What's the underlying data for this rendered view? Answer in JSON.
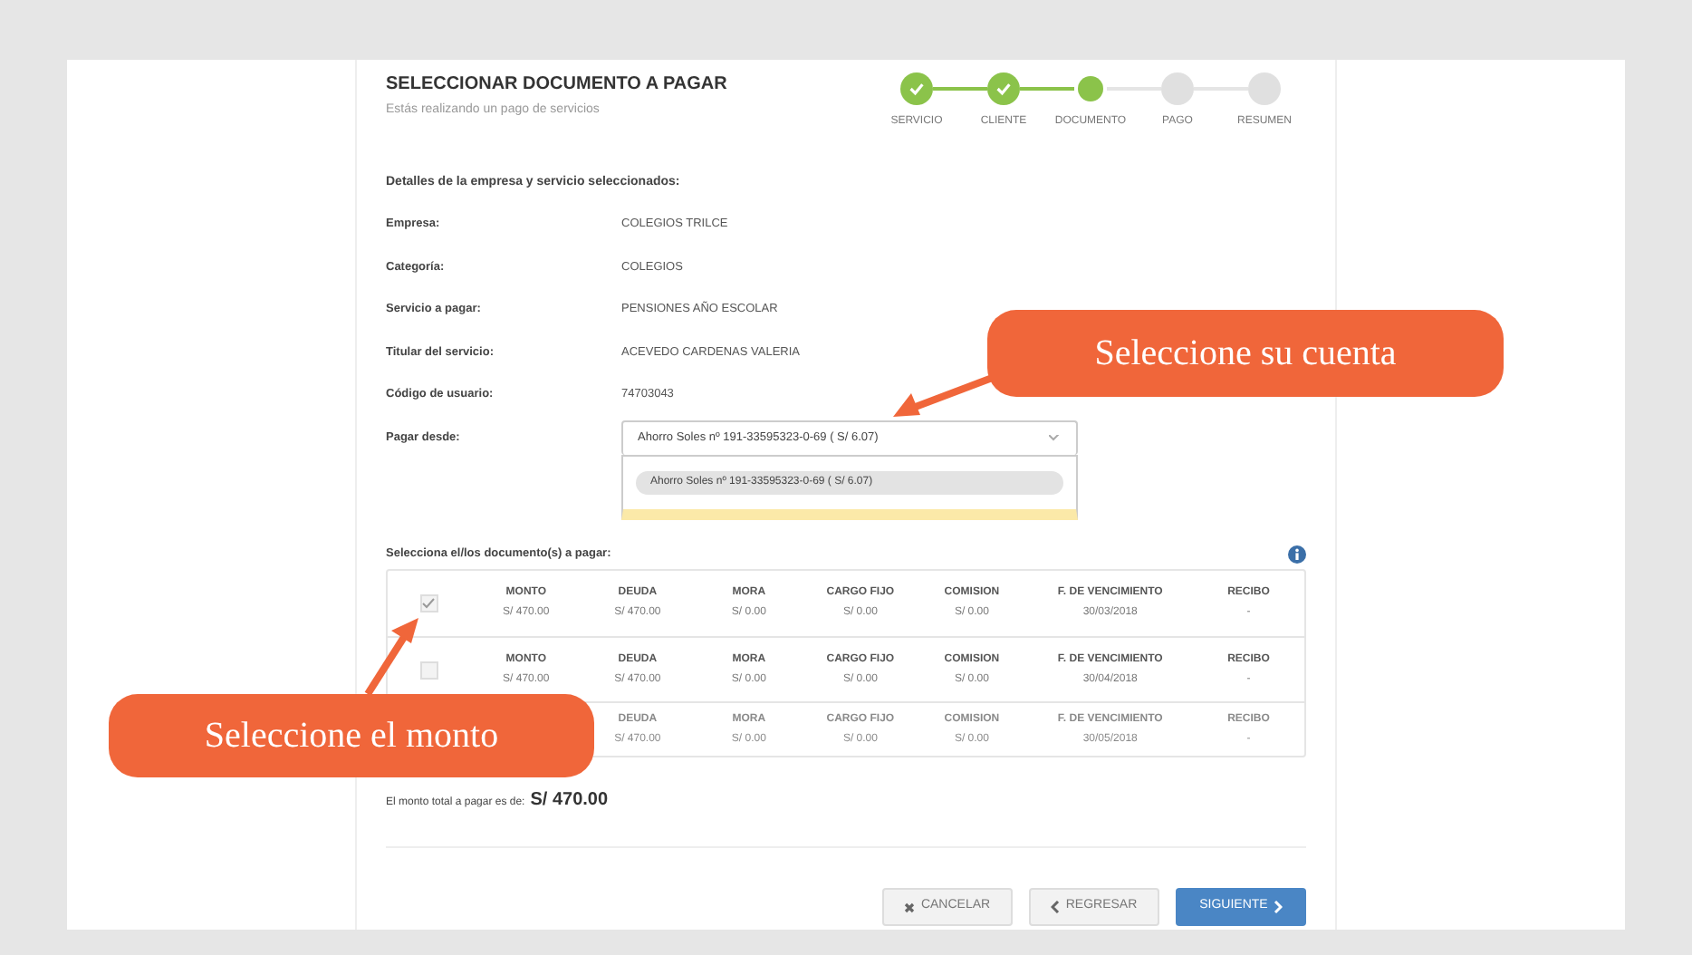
{
  "header": {
    "title": "SELECCIONAR DOCUMENTO A PAGAR",
    "subtitle": "Estás realizando un pago de servicios"
  },
  "steps": [
    {
      "label": "SERVICIO",
      "done": true,
      "current": false
    },
    {
      "label": "CLIENTE",
      "done": true,
      "current": false
    },
    {
      "label": "DOCUMENTO",
      "done": false,
      "current": true
    },
    {
      "label": "PAGO",
      "done": false,
      "current": false
    },
    {
      "label": "RESUMEN",
      "done": false,
      "current": false
    }
  ],
  "details": {
    "heading": "Detalles de la empresa y servicio seleccionados:",
    "fields": [
      {
        "label": "Empresa:",
        "value": "COLEGIOS TRILCE"
      },
      {
        "label": "Categoría:",
        "value": "COLEGIOS"
      },
      {
        "label": "Servicio a pagar:",
        "value": "PENSIONES AÑO ESCOLAR"
      },
      {
        "label": "Titular del servicio:",
        "value": "ACEVEDO CARDENAS VALERIA"
      },
      {
        "label": "Código de usuario:",
        "value": "74703043"
      }
    ]
  },
  "pay_from": {
    "label": "Pagar desde:",
    "value": "Ahorro Soles nº 191-33595323-0-69 ( S/ 6.07)",
    "expanded": true,
    "options": [
      {
        "label": "Ahorro Soles nº 191-33595323-0-69 ( S/ 6.07)",
        "selected": true
      }
    ]
  },
  "documents": {
    "heading": "Selecciona el/los documento(s) a pagar:",
    "rows": [
      {
        "checked": true,
        "faded": false,
        "cells": [
          {
            "label": "MONTO",
            "value": "S/ 470.00"
          },
          {
            "label": "DEUDA",
            "value": "S/ 470.00"
          },
          {
            "label": "MORA",
            "value": "S/ 0.00"
          },
          {
            "label": "CARGO FIJO",
            "value": "S/ 0.00"
          },
          {
            "label": "COMISION",
            "value": "S/ 0.00"
          },
          {
            "label": "F. DE VENCIMIENTO",
            "value": "30/03/2018"
          },
          {
            "label": "RECIBO",
            "value": "-"
          }
        ]
      },
      {
        "checked": false,
        "faded": false,
        "cells": [
          {
            "label": "MONTO",
            "value": "S/ 470.00"
          },
          {
            "label": "DEUDA",
            "value": "S/ 470.00"
          },
          {
            "label": "MORA",
            "value": "S/ 0.00"
          },
          {
            "label": "CARGO FIJO",
            "value": "S/ 0.00"
          },
          {
            "label": "COMISION",
            "value": "S/ 0.00"
          },
          {
            "label": "F. DE VENCIMIENTO",
            "value": "30/04/2018"
          },
          {
            "label": "RECIBO",
            "value": "-"
          }
        ]
      },
      {
        "faded": true,
        "cells": [
          {},
          {
            "label": "DEUDA",
            "value": "S/ 470.00"
          },
          {
            "label": "MORA",
            "value": "S/ 0.00"
          },
          {
            "label": "CARGO FIJO",
            "value": "S/ 0.00"
          },
          {
            "label": "COMISION",
            "value": "S/ 0.00"
          },
          {
            "label": "F. DE VENCIMIENTO",
            "value": "30/05/2018"
          },
          {
            "label": "RECIBO",
            "value": "-"
          }
        ]
      }
    ]
  },
  "total": {
    "label": "El monto total a pagar es de:",
    "amount": "S/ 470.00"
  },
  "buttons": [
    {
      "kind": "cancel",
      "label": "CANCELAR"
    },
    {
      "kind": "back",
      "label": "REGRESAR"
    },
    {
      "kind": "next",
      "label": "SIGUIENTE"
    }
  ],
  "callouts": [
    {
      "kind": "account",
      "text": "Seleccione su cuenta"
    },
    {
      "kind": "amount",
      "text": "Seleccione el monto"
    }
  ]
}
